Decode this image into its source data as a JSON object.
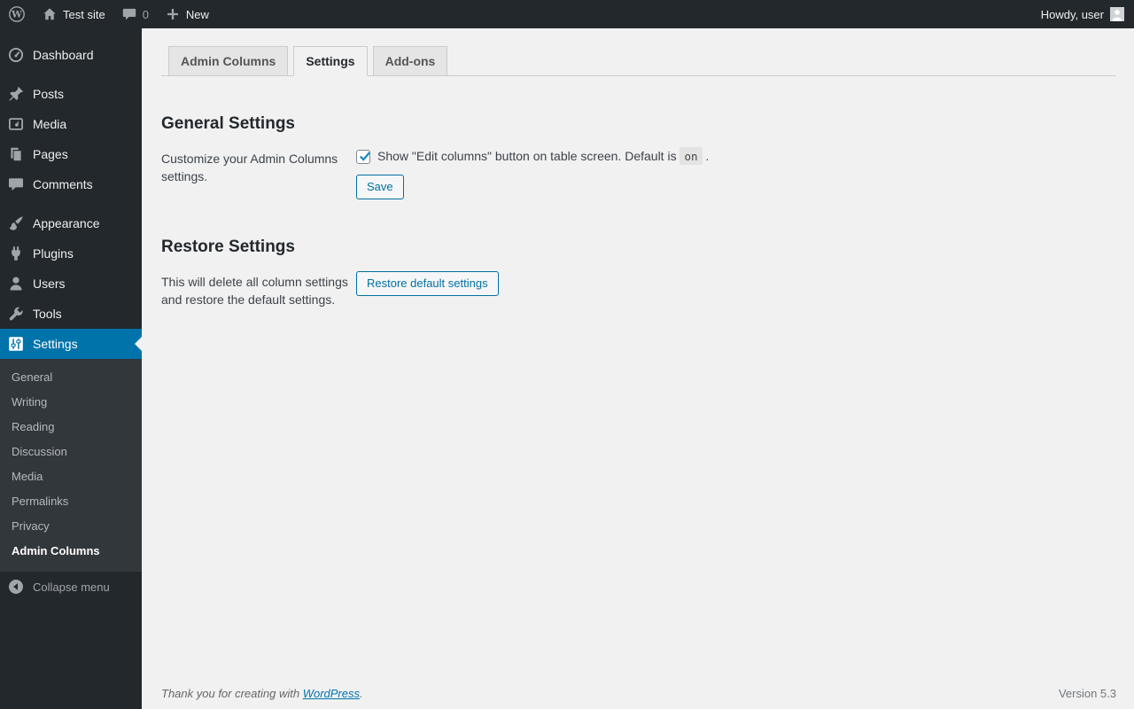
{
  "admin_bar": {
    "wordpress_icon": "wordpress-logo-icon",
    "site_icon": "home-icon",
    "site_name": "Test site",
    "comments_icon": "comment-bubble-icon",
    "comment_count": "0",
    "new_icon": "plus-icon",
    "new_label": "New",
    "howdy_label": "Howdy, user",
    "avatar_icon": "user-avatar-icon"
  },
  "sidebar": {
    "items": [
      {
        "label": "Dashboard",
        "icon": "dashboard-icon"
      },
      {
        "label": "Posts",
        "icon": "pushpin-icon",
        "separator_before": true
      },
      {
        "label": "Media",
        "icon": "media-icon"
      },
      {
        "label": "Pages",
        "icon": "pages-icon"
      },
      {
        "label": "Comments",
        "icon": "comment-bubble-icon"
      },
      {
        "label": "Appearance",
        "icon": "paintbrush-icon",
        "separator_before": true
      },
      {
        "label": "Plugins",
        "icon": "plugin-icon"
      },
      {
        "label": "Users",
        "icon": "person-icon"
      },
      {
        "label": "Tools",
        "icon": "wrench-icon"
      },
      {
        "label": "Settings",
        "icon": "sliders-icon",
        "active": true
      }
    ],
    "submenu": [
      {
        "label": "General"
      },
      {
        "label": "Writing"
      },
      {
        "label": "Reading"
      },
      {
        "label": "Discussion"
      },
      {
        "label": "Media"
      },
      {
        "label": "Permalinks"
      },
      {
        "label": "Privacy"
      },
      {
        "label": "Admin Columns",
        "current": true
      }
    ],
    "collapse": {
      "label": "Collapse menu",
      "icon": "collapse-arrow-icon"
    }
  },
  "tabs": [
    {
      "label": "Admin Columns"
    },
    {
      "label": "Settings",
      "active": true
    },
    {
      "label": "Add-ons"
    }
  ],
  "general_settings": {
    "heading": "General Settings",
    "description": "Customize your Admin Columns settings.",
    "checkbox_checked": true,
    "checkbox_text_before": "Show \"Edit columns\" button on table screen. Default is",
    "checkbox_code_value": "on",
    "checkbox_text_after": ".",
    "save_label": "Save"
  },
  "restore_settings": {
    "heading": "Restore Settings",
    "description": "This will delete all column settings and restore the default settings.",
    "button_label": "Restore default settings"
  },
  "footer": {
    "thanks_prefix": "Thank you for creating with ",
    "link_label": "WordPress",
    "thanks_suffix": ".",
    "version": "Version 5.3"
  },
  "colors": {
    "accent_blue": "#0073aa",
    "admin_bar_bg": "#23282d",
    "submenu_bg": "#32373c",
    "page_bg": "#f1f1f1",
    "button_blue": "#0071a1",
    "check_blue": "#1e8cbe"
  }
}
